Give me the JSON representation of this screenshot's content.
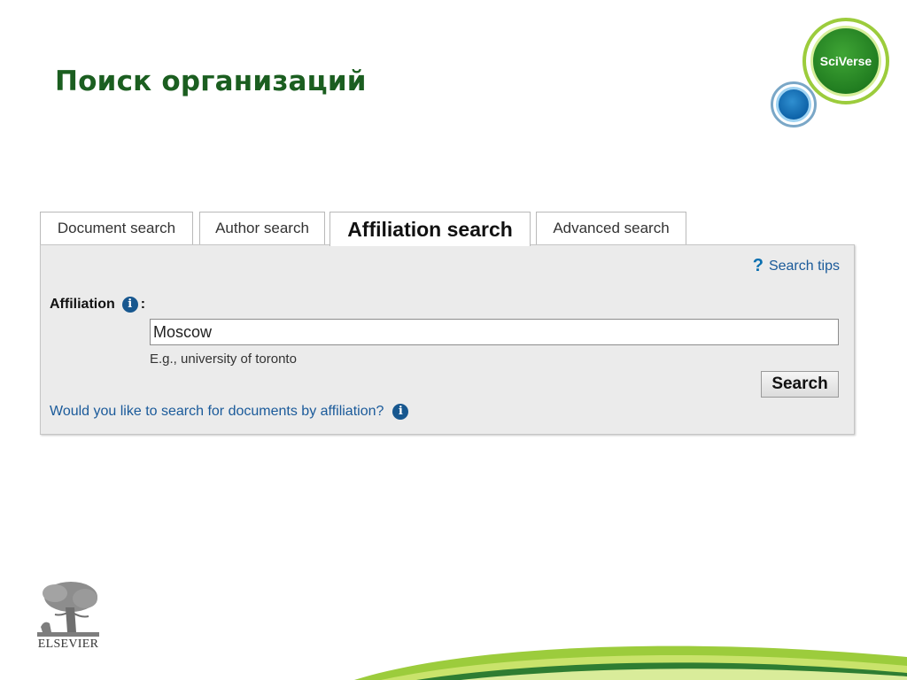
{
  "slide": {
    "title": "Поиск организаций"
  },
  "badge": {
    "brand": "SciVerse",
    "accent": "#2a8a2a"
  },
  "tabs": [
    {
      "label": "Document search",
      "active": false
    },
    {
      "label": "Author search",
      "active": false
    },
    {
      "label": "Affiliation search",
      "active": true
    },
    {
      "label": "Advanced search",
      "active": false
    }
  ],
  "panel": {
    "search_tips": "Search tips",
    "affiliation_label": "Affiliation",
    "affiliation_suffix": ":",
    "affiliation_value": "Moscow",
    "example": "E.g., university of toronto",
    "search_button": "Search",
    "doc_link": "Would you like to search for documents by affiliation?"
  },
  "footer": {
    "logo_text": "ELSEVIER"
  },
  "icons": {
    "help": "question-mark-icon",
    "info": "info-icon"
  },
  "colors": {
    "title": "#1b5e20",
    "link": "#1a5a9a",
    "panel": "#ebebeb"
  }
}
